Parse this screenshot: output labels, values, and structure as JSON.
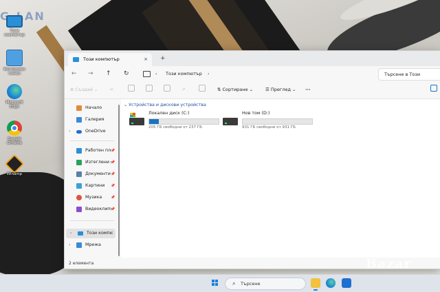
{
  "desktop": {
    "watermark_top": "G-LAN",
    "icons": [
      {
        "label": "Този компютър",
        "icon": "this-pc-icon"
      },
      {
        "label": "Контролен панел",
        "icon": "control-panel-icon"
      },
      {
        "label": "Microsoft Edge",
        "icon": "edge-icon"
      },
      {
        "label": "Google Chrome",
        "icon": "chrome-icon"
      },
      {
        "label": "Winamp",
        "icon": "winamp-icon"
      }
    ]
  },
  "explorer": {
    "tab": {
      "title": "Този компютър",
      "close": "×"
    },
    "new_tab": "+",
    "nav": {
      "back": "←",
      "forward": "→",
      "up": "↑",
      "refresh": "↻"
    },
    "address": {
      "crumb": "Този компютър",
      "sep": "›"
    },
    "search_placeholder": "Търсене в Този компютър",
    "commands": {
      "new": "Създай",
      "sort": "Сортиране",
      "view": "Преглед",
      "more": "···"
    },
    "sidebar": [
      {
        "label": "Начало",
        "icon": "home-icon"
      },
      {
        "label": "Галерия",
        "icon": "gallery-icon"
      },
      {
        "label": "OneDrive",
        "icon": "onedrive-icon"
      },
      {
        "label": "Работен пло",
        "icon": "desktop-folder-icon"
      },
      {
        "label": "Изтеглени ф",
        "icon": "downloads-icon"
      },
      {
        "label": "Документи",
        "icon": "documents-icon"
      },
      {
        "label": "Картини",
        "icon": "pictures-icon"
      },
      {
        "label": "Музика",
        "icon": "music-icon"
      },
      {
        "label": "Видеоклипо",
        "icon": "videos-icon"
      },
      {
        "label": "Този компютър",
        "icon": "this-pc-icon"
      },
      {
        "label": "Мрежа",
        "icon": "network-icon"
      }
    ],
    "group_title": "Устройства и дискови устройства",
    "drives": [
      {
        "name": "Локален диск (C:)",
        "free": "205 ГБ свободни от 237 ГБ",
        "used_fraction": 0.135
      },
      {
        "name": "Нов том (D:)",
        "free": "931 ГБ свободни от 931 ГБ",
        "used_fraction": 0.0
      }
    ],
    "status": "2 елемента"
  },
  "taskbar": {
    "search": "Търсене"
  },
  "watermark": "Bazar",
  "colors": {
    "accent": "#1a73c4",
    "folder_blue": "#2b8fd8"
  }
}
